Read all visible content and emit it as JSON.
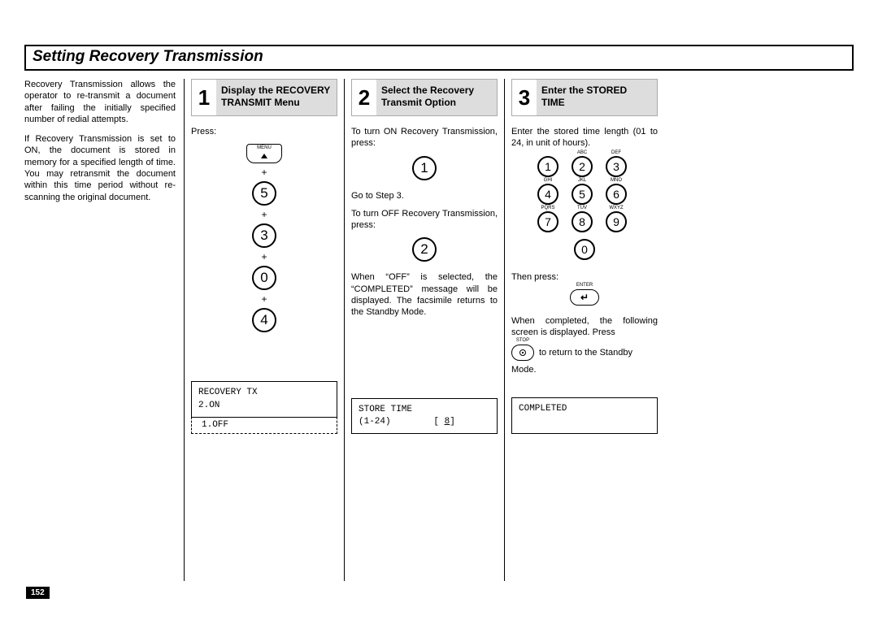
{
  "title": "Setting Recovery Transmission",
  "page_number": "152",
  "intro": {
    "p1": "Recovery Transmission allows the operator to re-transmit a document after  failing the initially specified number of redial attempts.",
    "p2": "If Recovery Transmission is set to ON, the document is stored in memory for a specified length of time. You may retransmit the document within this time period without re-scanning the original document."
  },
  "step1": {
    "num": "1",
    "title": "Display the RECOVERY TRANSMIT Menu",
    "press": "Press:",
    "menu_label": "MENU",
    "keys": [
      "5",
      "3",
      "0",
      "4"
    ],
    "plus": "+",
    "lcd_line1": "RECOVERY TX",
    "lcd_line2": "2.ON",
    "lcd_extra": "1.OFF"
  },
  "step2": {
    "num": "2",
    "title": "Select the Recovery Transmit Option",
    "text_on": "To turn ON Recovery Transmission, press:",
    "key_on": "1",
    "goto": "Go to Step 3.",
    "text_off": "To turn OFF Recovery Transmission, press:",
    "key_off": "2",
    "text_off2": "When “OFF” is selected, the “COMPLETED” message will be displayed. The facsimile returns to the Standby Mode.",
    "lcd_line1": "STORE TIME",
    "lcd_line2": "(1-24)        [ ",
    "lcd_value": "8",
    "lcd_line2_suffix": "]"
  },
  "step3": {
    "num": "3",
    "title": "Enter the STORED TIME",
    "text1": "Enter the stored time length (01 to 24, in unit of hours).",
    "keypad_sub": [
      "",
      "ABC",
      "DEF",
      "GHI",
      "JKL",
      "MNO",
      "PQRS",
      "TUV",
      "WXYZ"
    ],
    "keypad": [
      "1",
      "2",
      "3",
      "4",
      "5",
      "6",
      "7",
      "8",
      "9",
      "0"
    ],
    "then": "Then press:",
    "enter_label": "ENTER",
    "text2": "When completed, the following screen is displayed. Press",
    "stop_label": "STOP",
    "stop_after": "to return to the Standby",
    "mode": "Mode.",
    "lcd_line1": "COMPLETED"
  }
}
